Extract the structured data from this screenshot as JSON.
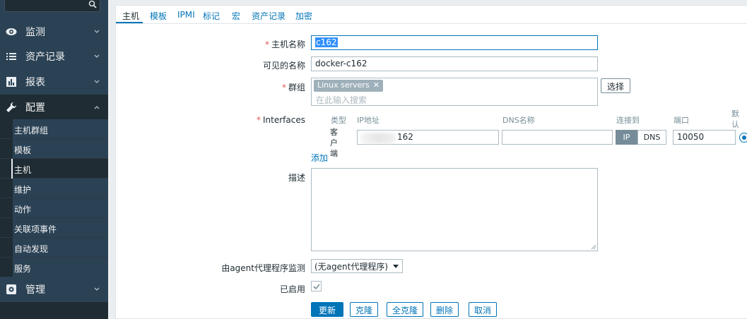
{
  "sidebar": {
    "search_icon": "search-icon",
    "menu": [
      {
        "label": "监测",
        "icon": "eye-icon"
      },
      {
        "label": "资产记录",
        "icon": "list-icon"
      },
      {
        "label": "报表",
        "icon": "bar-chart-icon"
      },
      {
        "label": "配置",
        "icon": "wrench-icon"
      },
      {
        "label": "管理",
        "icon": "gear-icon"
      }
    ],
    "submenu": [
      {
        "label": "主机群组"
      },
      {
        "label": "模板"
      },
      {
        "label": "主机"
      },
      {
        "label": "维护"
      },
      {
        "label": "动作"
      },
      {
        "label": "关联项事件"
      },
      {
        "label": "自动发现"
      },
      {
        "label": "服务"
      }
    ]
  },
  "tabs": [
    {
      "label": "主机"
    },
    {
      "label": "模板"
    },
    {
      "label": "IPMI"
    },
    {
      "label": "标记"
    },
    {
      "label": "宏"
    },
    {
      "label": "资产记录"
    },
    {
      "label": "加密"
    }
  ],
  "form": {
    "host_name": {
      "label": "主机名称",
      "value": "c162"
    },
    "visible_name": {
      "label": "可见的名称",
      "value": "docker-c162"
    },
    "groups": {
      "label": "群组",
      "tag": "Linux servers",
      "placeholder": "在此输入搜索",
      "select_button": "选择"
    },
    "interfaces": {
      "label": "Interfaces",
      "headers": {
        "type": "类型",
        "ip": "IP地址",
        "dns": "DNS名称",
        "connect": "连接到",
        "port": "端口",
        "default": "默认"
      },
      "row": {
        "type": "客户端",
        "ip_suffix": "162",
        "dns": "",
        "connect_ip": "IP",
        "connect_dns": "DNS",
        "port": "10050"
      },
      "add_link": "添加"
    },
    "description": {
      "label": "描述",
      "value": ""
    },
    "proxy": {
      "label": "由agent代理程序监测",
      "value": "(无agent代理程序)"
    },
    "enabled": {
      "label": "已启用",
      "checked": true
    }
  },
  "buttons": {
    "update": "更新",
    "clone": "克隆",
    "full_clone": "全克隆",
    "delete": "删除",
    "cancel": "取消"
  }
}
